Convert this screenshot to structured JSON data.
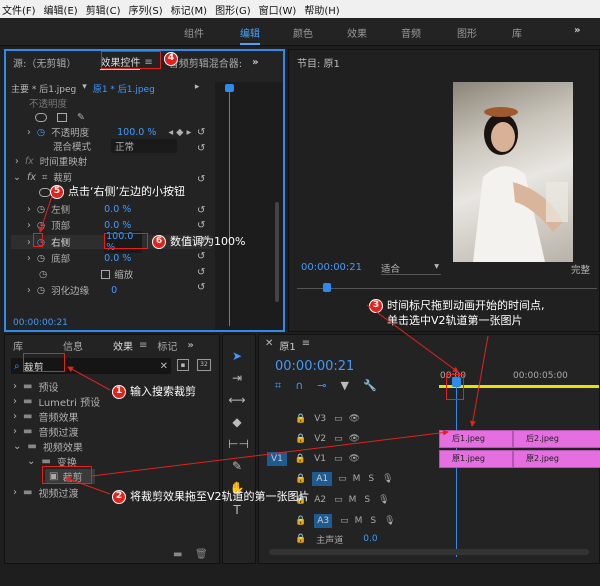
{
  "menu": [
    "文件(F)",
    "编辑(E)",
    "剪辑(C)",
    "序列(S)",
    "标记(M)",
    "图形(G)",
    "窗口(W)",
    "帮助(H)"
  ],
  "workspaces": [
    "组件",
    "编辑",
    "颜色",
    "效果",
    "音频",
    "图形",
    "库"
  ],
  "source_panel": {
    "source_tab": "源:（无剪辑）",
    "effects_tab": "效果控件",
    "mixer_tab": "音频剪辑混合器:",
    "clip_path": "主要 * 后1.jpeg",
    "clip_active": "原1 * 后1.jpeg",
    "rows": {
      "opacity_label": "不透明度",
      "opacity_val": "100.0 %",
      "blend_label": "混合模式",
      "blend_val": "正常",
      "time_remap": "时间重映射",
      "crop": "裁剪",
      "left": "左侧",
      "left_val": "0.0 %",
      "top": "顶部",
      "top_val": "0.0 %",
      "right": "右侧",
      "right_val": "100.0 %",
      "bottom": "底部",
      "bottom_val": "0.0 %",
      "zoom": "缩放",
      "feather": "羽化边缘",
      "feather_val": "0"
    },
    "opacity_section": "不透明度",
    "timecode": "00:00:00:21"
  },
  "program": {
    "title": "节目: 原1",
    "timecode": "00:00:00:21",
    "fit": "适合",
    "quality": "完整"
  },
  "effects_panel": {
    "tabs": [
      "库",
      "信息",
      "效果",
      "标记"
    ],
    "search_value": "裁剪",
    "folders": [
      "预设",
      "Lumetri 预设",
      "音频效果",
      "音频过渡",
      "视频效果"
    ],
    "subfolder": "变换",
    "effect": "裁剪",
    "after": "视频过渡"
  },
  "timeline": {
    "tab": "原1",
    "timecode": "00:00:00:21",
    "ruler": [
      "00:00",
      "00:00:05:00"
    ],
    "tracks": [
      "V3",
      "V2",
      "V1",
      "A1",
      "A2",
      "A3"
    ],
    "master": "主声道",
    "master_val": "0.0",
    "v1_patch": "V1",
    "clips_v2": [
      "后1.jpeg",
      "后2.jpeg"
    ],
    "clips_v1": [
      "原1.jpeg",
      "原2.jpeg"
    ]
  },
  "annotations": {
    "a1": "输入搜索裁剪",
    "a2": "将裁剪效果拖至V2轨道的第一张图片",
    "a3_line1": "时间标尺拖到动画开始的时间点,",
    "a3_line2": "单击选中V2轨道第一张图片",
    "a4": "4",
    "a5": "点击‘右侧’左边的小按钮",
    "a6": "数值调为100%",
    "n1": "1",
    "n2": "2",
    "n3": "3",
    "n5": "5",
    "n6": "6"
  },
  "colors": {
    "accent": "#2d8ceb",
    "clip": "#e56fe0",
    "annotation": "#e3231b"
  }
}
